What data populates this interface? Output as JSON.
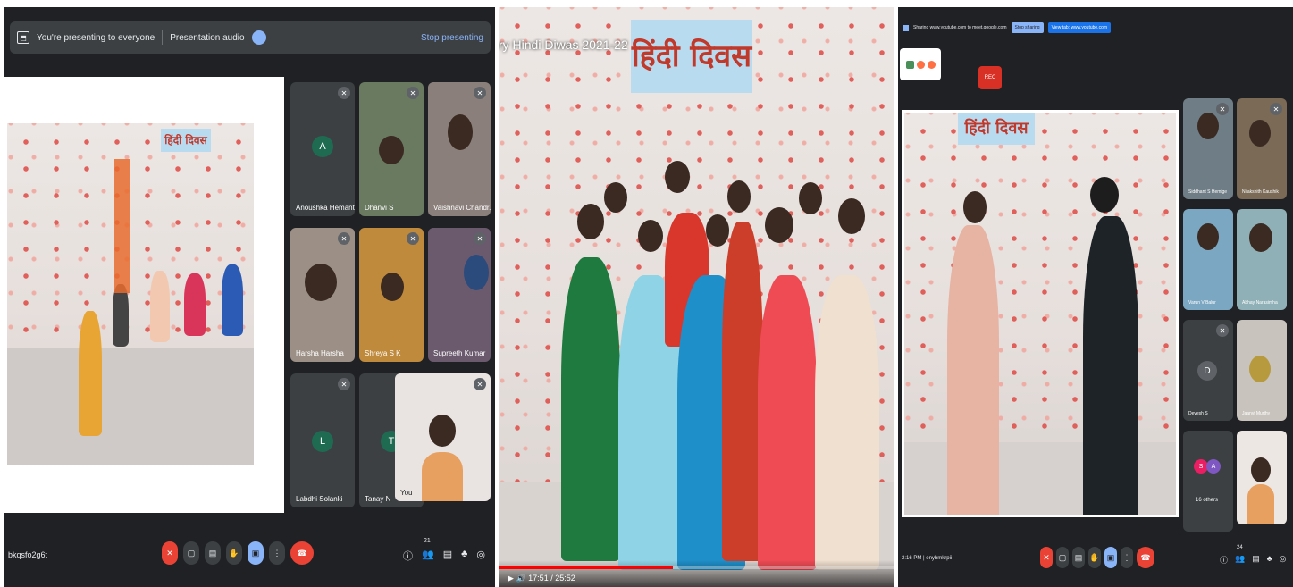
{
  "panel1": {
    "present_text": "You're presenting to everyone",
    "audio_label": "Presentation audio",
    "stop_label": "Stop presenting",
    "tiles": [
      {
        "name": "Anoushka Hemanth",
        "avatar": "A"
      },
      {
        "name": "Dhanvi S"
      },
      {
        "name": "Vaishnavi Chandr..."
      },
      {
        "name": "Harsha Harsha"
      },
      {
        "name": "Shreya S K"
      },
      {
        "name": "Supreeth Kumar"
      },
      {
        "name": "Labdhi Solanki",
        "avatar": "L"
      },
      {
        "name": "Tanay N",
        "avatar": "T"
      },
      {
        "name": "You"
      }
    ],
    "meeting_code": "bkqsfo2g6t",
    "participants_count": "21",
    "banner": "हिंदी दिवस"
  },
  "panel2": {
    "video_title": "ry Hindi Diwas 2021-22",
    "banner": "हिंदी दिवस",
    "time": "17:51 / 25:52",
    "progress": 0.44
  },
  "panel3": {
    "share_text": "Sharing www.youtube.com to meet.google.com",
    "stop_sharing": "Stop sharing",
    "view_tab": "View tab: www.youtube.com",
    "rec_label": "REC",
    "banner": "हिंदी दिवस",
    "tiles": [
      {
        "name": "Siddhant S Hemige"
      },
      {
        "name": "Nilakshith Kaushik"
      },
      {
        "name": "Varun V Balur"
      },
      {
        "name": "Abhay Narasimha"
      },
      {
        "name": "Devesh S",
        "avatar": "D"
      },
      {
        "name": "Jaanvi Murthy"
      },
      {
        "name": "16 others"
      },
      {
        "name": ""
      }
    ],
    "others_avatars": [
      "S",
      "A"
    ],
    "time_code": "2:16 PM  |  enybmkrpii",
    "participants_count": "24"
  }
}
